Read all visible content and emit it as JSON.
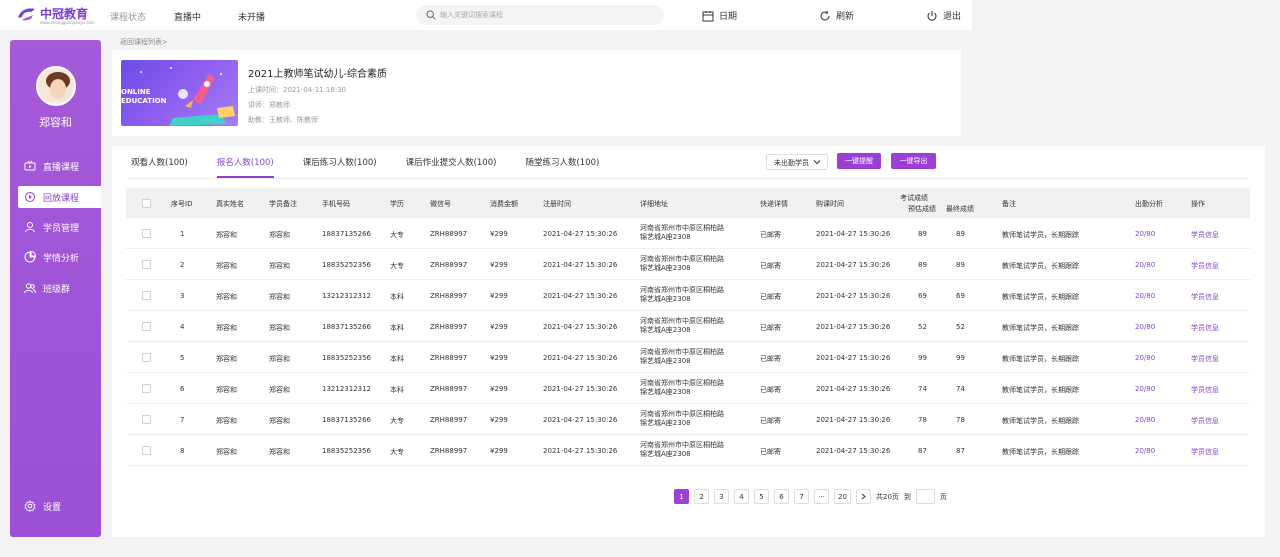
{
  "brand": {
    "name": "中冠教育",
    "sub": "www.zhongguanjiaoyu.com"
  },
  "topnav": {
    "status_label": "课程状态",
    "live_label": "直播中",
    "pending_label": "未开播"
  },
  "search": {
    "placeholder": "输入关键词搜索课程"
  },
  "top_actions": {
    "calendar": "日期",
    "refresh": "刷新",
    "logout": "退出"
  },
  "user": {
    "name": "郑容和"
  },
  "sidebar": {
    "items": [
      {
        "label": "直播课程",
        "icon": "live-icon"
      },
      {
        "label": "回放课程",
        "icon": "replay-icon",
        "active": true
      },
      {
        "label": "学员管理",
        "icon": "user-icon"
      },
      {
        "label": "学情分析",
        "icon": "analytics-icon"
      },
      {
        "label": "班级群",
        "icon": "group-icon"
      }
    ],
    "settings_label": "设置"
  },
  "breadcrumb": "返回课程列表>",
  "course": {
    "thumb_text_1": "ONLINE",
    "thumb_text_2": "EDUCATION",
    "title": "2021上教师笔试幼儿-综合素质",
    "time": "上课时间：2021-04-11 18:30",
    "teacher": "讲师：郑教师",
    "assistant": "助教：王教师、陈教师"
  },
  "tabs": [
    {
      "label": "观看人数(100)"
    },
    {
      "label": "报名人数(100)",
      "active": true
    },
    {
      "label": "课后练习人数(100)"
    },
    {
      "label": "课后作业提交人数(100)"
    },
    {
      "label": "随堂练习人数(100)"
    }
  ],
  "filter": {
    "selected": "未出勤学员"
  },
  "buttons": {
    "remind": "一键提醒",
    "export": "一键导出"
  },
  "table": {
    "headers": {
      "id": "序号ID",
      "real_name": "真实姓名",
      "note_name": "学员备注",
      "phone": "手机号码",
      "edu": "学历",
      "wechat": "微信号",
      "amount": "消费金额",
      "reg_time": "注册时间",
      "address": "详细地址",
      "express": "快递详情",
      "buy_time": "购课时间",
      "score_group": "考试成绩",
      "est_score": "预估成绩",
      "final_score": "最终成绩",
      "remark": "备注",
      "attendance": "出勤分析",
      "action": "操作"
    },
    "rows": [
      {
        "id": "1",
        "name": "郑容和",
        "note": "郑容和",
        "phone": "18837135266",
        "edu": "大专",
        "wechat": "ZRH88997",
        "amount": "¥299",
        "reg": "2021-04-27 15:30:26",
        "addr1": "河南省郑州市中原区桐柏路",
        "addr2": "锦艺城A座2308",
        "express": "已邮寄",
        "buy": "2021-04-27 15:30:26",
        "est": "89",
        "final": "89",
        "remark": "教师笔试学员，长期跟踪",
        "att": "20/80",
        "action": "学员信息"
      },
      {
        "id": "2",
        "name": "郑容和",
        "note": "郑容和",
        "phone": "18835252356",
        "edu": "大专",
        "wechat": "ZRH88997",
        "amount": "¥299",
        "reg": "2021-04-27 15:30:26",
        "addr1": "河南省郑州市中原区桐柏路",
        "addr2": "锦艺城A座2308",
        "express": "已邮寄",
        "buy": "2021-04-27 15:30:26",
        "est": "89",
        "final": "89",
        "remark": "教师笔试学员，长期跟踪",
        "att": "20/80",
        "action": "学员信息"
      },
      {
        "id": "3",
        "name": "郑容和",
        "note": "郑容和",
        "phone": "13212312312",
        "edu": "本科",
        "wechat": "ZRH88997",
        "amount": "¥299",
        "reg": "2021-04-27 15:30:26",
        "addr1": "河南省郑州市中原区桐柏路",
        "addr2": "锦艺城A座2308",
        "express": "已邮寄",
        "buy": "2021-04-27 15:30:26",
        "est": "69",
        "final": "69",
        "remark": "教师笔试学员，长期跟踪",
        "att": "20/80",
        "action": "学员信息"
      },
      {
        "id": "4",
        "name": "郑容和",
        "note": "郑容和",
        "phone": "18837135266",
        "edu": "本科",
        "wechat": "ZRH88997",
        "amount": "¥299",
        "reg": "2021-04-27 15:30:26",
        "addr1": "河南省郑州市中原区桐柏路",
        "addr2": "锦艺城A座2308",
        "express": "已邮寄",
        "buy": "2021-04-27 15:30:26",
        "est": "52",
        "final": "52",
        "remark": "教师笔试学员，长期跟踪",
        "att": "20/80",
        "action": "学员信息"
      },
      {
        "id": "5",
        "name": "郑容和",
        "note": "郑容和",
        "phone": "18835252356",
        "edu": "本科",
        "wechat": "ZRH88997",
        "amount": "¥299",
        "reg": "2021-04-27 15:30:26",
        "addr1": "河南省郑州市中原区桐柏路",
        "addr2": "锦艺城A座2308",
        "express": "已邮寄",
        "buy": "2021-04-27 15:30:26",
        "est": "99",
        "final": "99",
        "remark": "教师笔试学员，长期跟踪",
        "att": "20/80",
        "action": "学员信息"
      },
      {
        "id": "6",
        "name": "郑容和",
        "note": "郑容和",
        "phone": "13212312312",
        "edu": "本科",
        "wechat": "ZRH88997",
        "amount": "¥299",
        "reg": "2021-04-27 15:30:26",
        "addr1": "河南省郑州市中原区桐柏路",
        "addr2": "锦艺城A座2308",
        "express": "已邮寄",
        "buy": "2021-04-27 15:30:26",
        "est": "74",
        "final": "74",
        "remark": "教师笔试学员，长期跟踪",
        "att": "20/80",
        "action": "学员信息"
      },
      {
        "id": "7",
        "name": "郑容和",
        "note": "郑容和",
        "phone": "18837135266",
        "edu": "大专",
        "wechat": "ZRH88997",
        "amount": "¥299",
        "reg": "2021-04-27 15:30:26",
        "addr1": "河南省郑州市中原区桐柏路",
        "addr2": "锦艺城A座2308",
        "express": "已邮寄",
        "buy": "2021-04-27 15:30:26",
        "est": "78",
        "final": "78",
        "remark": "教师笔试学员，长期跟踪",
        "att": "20/80",
        "action": "学员信息"
      },
      {
        "id": "8",
        "name": "郑容和",
        "note": "郑容和",
        "phone": "18835252356",
        "edu": "大专",
        "wechat": "ZRH88997",
        "amount": "¥299",
        "reg": "2021-04-27 15:30:26",
        "addr1": "河南省郑州市中原区桐柏路",
        "addr2": "锦艺城A座2308",
        "express": "已邮寄",
        "buy": "2021-04-27 15:30:26",
        "est": "87",
        "final": "87",
        "remark": "教师笔试学员，长期跟踪",
        "att": "20/80",
        "action": "学员信息"
      }
    ]
  },
  "pagination": {
    "pages": [
      "1",
      "2",
      "3",
      "4",
      "5",
      "6",
      "7",
      "···",
      "20"
    ],
    "current": "1",
    "total": "共20页",
    "goto_label": "到",
    "page_unit": "页"
  },
  "colors": {
    "accent": "#9b3fd6",
    "accent_text": "#8a3fd0"
  }
}
